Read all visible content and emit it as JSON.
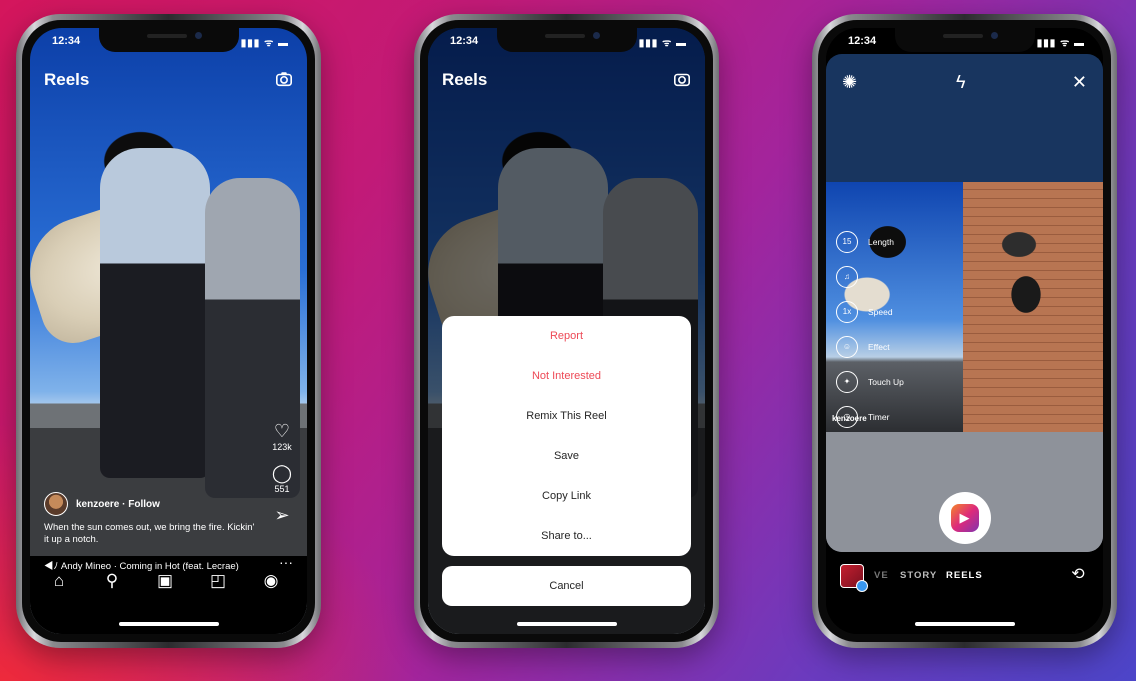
{
  "phones": {
    "left": {
      "status_time": "12:34",
      "status_icons": "▮▮▮ ᯤ ▬",
      "title": "Reels",
      "actions": [
        {
          "icon": "heart-icon",
          "count": "123k"
        },
        {
          "icon": "comment-icon",
          "count": "551"
        },
        {
          "icon": "send-icon",
          "count": ""
        }
      ],
      "user": "kenzoere · Follow",
      "caption": "When the sun comes out, we bring the fire. Kickin' it up a notch.",
      "audio": "◀ﾉ Andy Mineo · Coming in Hot (feat. Lecrae)",
      "more": "···",
      "nav": [
        {
          "icon": "home-icon",
          "glyph": "⌂"
        },
        {
          "icon": "search-icon",
          "glyph": "⚲"
        },
        {
          "icon": "reels-icon",
          "glyph": "▣"
        },
        {
          "icon": "shop-icon",
          "glyph": "◰"
        },
        {
          "icon": "profile-icon",
          "glyph": "◉"
        }
      ]
    },
    "middle": {
      "status_time": "12:34",
      "status_icons": "▮▮▮ ᯤ ▬",
      "title": "Reels",
      "menu": [
        {
          "label": "Report",
          "danger": true
        },
        {
          "label": "Not Interested",
          "danger": true
        },
        {
          "label": "Remix This Reel",
          "danger": false
        },
        {
          "label": "Save",
          "danger": false
        },
        {
          "label": "Copy Link",
          "danger": false
        },
        {
          "label": "Share to...",
          "danger": false
        }
      ],
      "cancel": "Cancel"
    },
    "right": {
      "status_time": "12:34",
      "status_icons": "▮▮▮ ᯤ ▬",
      "top_icons": {
        "settings": "✺",
        "flash": "ϟ",
        "close": "✕"
      },
      "tools": [
        {
          "icon": "length-icon",
          "glyph": "15",
          "label": "Length"
        },
        {
          "icon": "audio-icon",
          "glyph": "♫",
          "label": ""
        },
        {
          "icon": "speed-icon",
          "glyph": "1x",
          "label": "Speed"
        },
        {
          "icon": "effects-icon",
          "glyph": "☺",
          "label": "Effect"
        },
        {
          "icon": "touchup-icon",
          "glyph": "✦",
          "label": "Touch Up"
        },
        {
          "icon": "timer-icon",
          "glyph": "◷",
          "label": "Timer"
        }
      ],
      "user": "kenzoere",
      "modes": {
        "live": "VE",
        "story": "STORY",
        "reels": "REELS"
      },
      "flip_glyph": "⟲"
    }
  },
  "colors": {
    "accent_red": "#ed4956",
    "text_dark": "#262626"
  }
}
